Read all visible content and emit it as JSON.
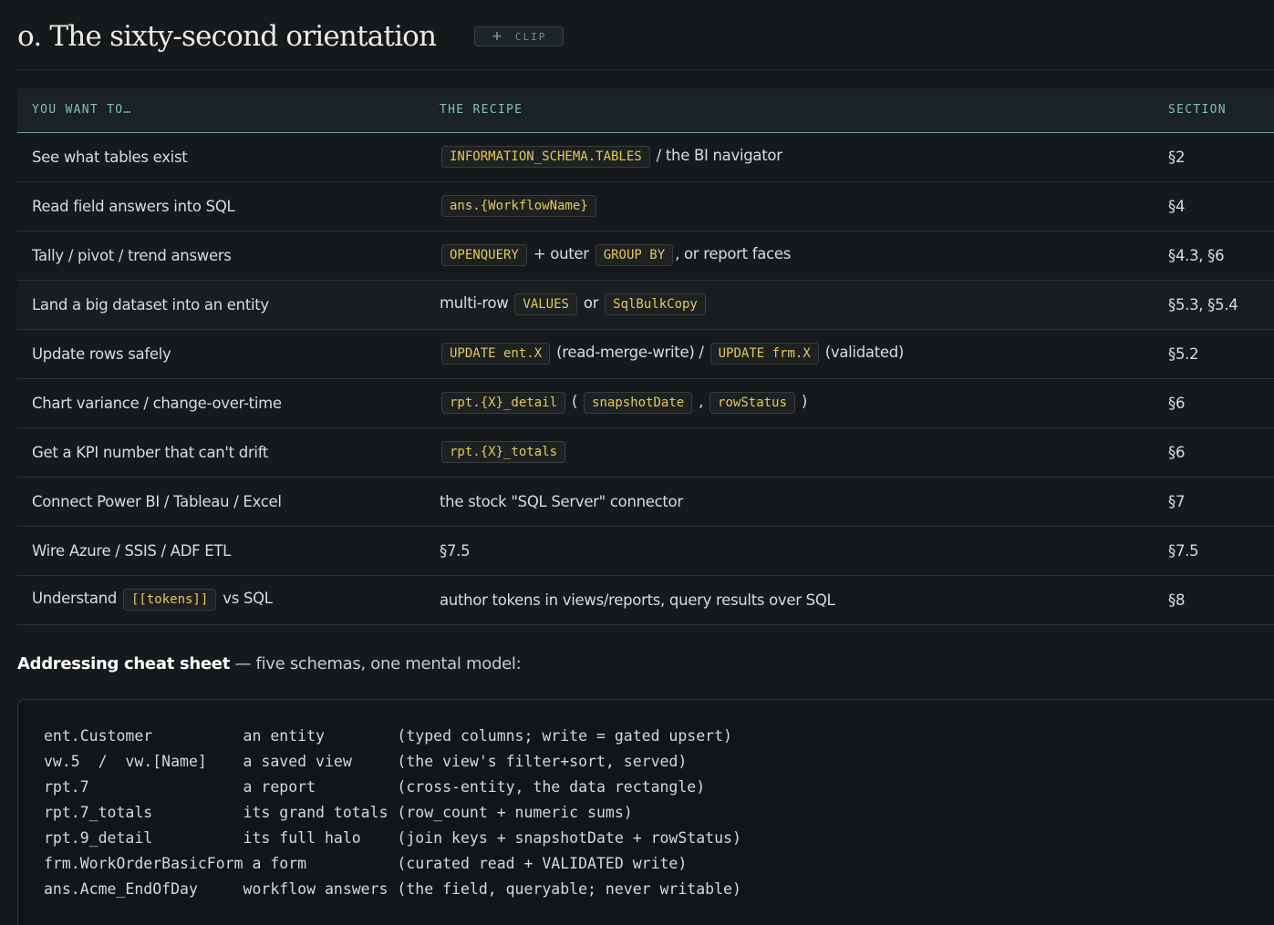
{
  "section": {
    "title": "o. The sixty-second orientation",
    "clip_icon": "+",
    "clip_label": "CLIP"
  },
  "table": {
    "headers": [
      "YOU WANT TO…",
      "THE RECIPE",
      "SECTION"
    ],
    "rows": [
      {
        "want": "See what tables exist",
        "code1": "INFORMATION_SCHEMA.TABLES",
        "text1": " / the BI navigator",
        "section": "§2"
      },
      {
        "want": "Read field answers into SQL",
        "code1": "ans.{WorkflowName}",
        "section": "§4"
      },
      {
        "want": "Tally / pivot / trend answers",
        "code1": "OPENQUERY",
        "text1": " + outer ",
        "code2": "GROUP BY",
        "text2": ", or report faces",
        "section": "§4.3, §6"
      },
      {
        "want": "Land a big dataset into an entity",
        "text0": "multi-row ",
        "code1": "VALUES",
        "text1": " or ",
        "code2": "SqlBulkCopy",
        "section": "§5.3, §5.4"
      },
      {
        "want": "Update rows safely",
        "code1": "UPDATE ent.X",
        "text1": " (read-merge-write) / ",
        "code2": "UPDATE frm.X",
        "text2": " (validated)",
        "section": "§5.2"
      },
      {
        "want": "Chart variance / change-over-time",
        "code1": "rpt.{X}_detail",
        "text1": " ( ",
        "code2": "snapshotDate",
        "text2": " , ",
        "code3": "rowStatus",
        "text3": " )",
        "section": "§6"
      },
      {
        "want": "Get a KPI number that can't drift",
        "code1": "rpt.{X}_totals",
        "section": "§6"
      },
      {
        "want": "Connect Power BI / Tableau / Excel",
        "text0": "the stock \"SQL Server\" connector",
        "section": "§7"
      },
      {
        "want": "Wire Azure / SSIS / ADF ETL",
        "text0": "§7.5",
        "section": "§7.5"
      },
      {
        "want_pre": "Understand ",
        "want_code": "[[tokens]]",
        "want_post": " vs SQL",
        "text0": "author tokens in views/reports, query results over SQL",
        "section": "§8"
      }
    ]
  },
  "cheat": {
    "title": "Addressing cheat sheet",
    "subtitle": " — five schemas, one mental model:"
  },
  "codeblock": {
    "text": "ent.Customer          an entity        (typed columns; write = gated upsert)\nvw.5  /  vw.[Name]    a saved view     (the view's filter+sort, served)\nrpt.7                 a report         (cross-entity, the data rectangle)\nrpt.7_totals          its grand totals (row_count + numeric sums)\nrpt.9_detail          its full halo    (join keys + snapshotDate + rowStatus)\nfrm.WorkOrderBasicForm a form          (curated read + VALIDATED write)\nans.Acme_EndOfDay     workflow answers (the field, queryable; never writable)"
  },
  "colors": {
    "background": "#15191b",
    "header_accent": "#7cc3b1",
    "code_token": "#e6c75b"
  },
  "icons": {
    "clip": "plus-icon"
  }
}
